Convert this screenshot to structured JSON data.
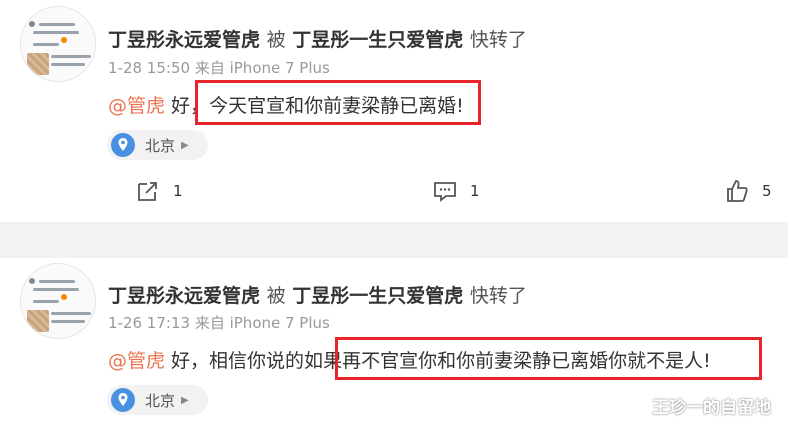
{
  "posts": [
    {
      "author": "丁昱彤永远爱管虎",
      "by_word": "被",
      "original_author": "丁昱彤一生只爱管虎",
      "action_word": "快转了",
      "date": "1-28 15:50",
      "source": "来自 iPhone 7 Plus",
      "mention": "@管虎",
      "prefix_text": " 好，",
      "highlight_text": "今天官宣和你前妻梁静已离婚!",
      "location": "北京",
      "actions": {
        "repost_count": "1",
        "comment_count": "1",
        "like_count": "5"
      },
      "icons": {
        "location": "location-pin-icon",
        "repost": "repost-icon",
        "comment": "comment-icon",
        "like": "thumbs-up-icon"
      }
    },
    {
      "author": "丁昱彤永远爱管虎",
      "by_word": "被",
      "original_author": "丁昱彤一生只爱管虎",
      "action_word": "快转了",
      "date": "1-26 17:13",
      "source": "来自 iPhone 7 Plus",
      "mention": "@管虎",
      "prefix_text": " 好，相信你说的如",
      "highlight_text": "果再不官宣你和你前妻梁静已离婚你就不是人!",
      "location": "北京"
    }
  ],
  "watermark": "王珍一的自留地",
  "colors": {
    "mention": "#eb7350",
    "highlight_box": "#e8242b",
    "location_pin": "#4a90e2",
    "separator": "#f2f2f2"
  }
}
